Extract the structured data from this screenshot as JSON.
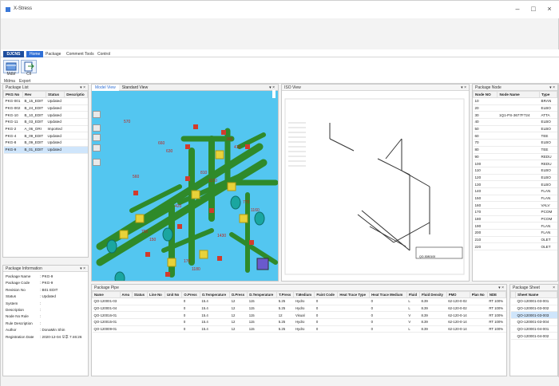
{
  "window": {
    "title": "X-Stress"
  },
  "ribbon": {
    "logo": "DJCNS",
    "tabs": [
      "Home",
      "Package",
      "Comment Tools",
      "Control"
    ],
    "active_tab": "Home",
    "buttons": [
      {
        "label": "Mdbf",
        "icon": "database-icon"
      },
      {
        "label": "Cll",
        "icon": "export-arrow-icon"
      }
    ],
    "groups": [
      "Mdma",
      "Export"
    ]
  },
  "package_list": {
    "title": "Package List",
    "columns": [
      "PKG No",
      "Rev",
      "Status",
      "Descriptio"
    ],
    "rows": [
      [
        "PKG-001",
        "B_15_EDIT",
        "Updated",
        ""
      ],
      [
        "PKG-002",
        "B_24_EDIT",
        "Updated",
        ""
      ],
      [
        "PKG-10",
        "B_10_EDIT",
        "Updated",
        ""
      ],
      [
        "PKG-11",
        "B_03_EDIT",
        "Updated",
        ""
      ],
      [
        "PKG-2",
        "A_06_ORI",
        "Imported",
        ""
      ],
      [
        "PKG-4",
        "B_09_EDIT",
        "Updated",
        ""
      ],
      [
        "PKG-8",
        "B_09_EDIT",
        "Updated",
        ""
      ],
      [
        "PKG-9",
        "B_01_EDIT",
        "Updated",
        ""
      ]
    ],
    "selected_index": 7
  },
  "package_information": {
    "title": "Package Information",
    "fields": [
      [
        "Package Name",
        ": PKG-9"
      ],
      [
        "Package Code",
        ": PKG-9"
      ],
      [
        "Revision No",
        ": B01 EDIT"
      ],
      [
        "Status",
        ": Updated"
      ],
      [
        "System",
        ":"
      ],
      [
        "Description",
        ":"
      ],
      [
        "Node No Rule",
        ":"
      ],
      [
        "Rule Description",
        ":"
      ],
      [
        "Author",
        ": DonaMin Shin"
      ],
      [
        "Registration Date",
        ": 2020-12-04 오후 7:46:26"
      ]
    ]
  },
  "model_view": {
    "tabs": [
      "Model View",
      "Standard View"
    ],
    "active": "Model View",
    "labels": [
      "570",
      "630",
      "1170",
      "1160",
      "150",
      "1180",
      "410",
      "560",
      "420",
      "1430",
      "1150",
      "660",
      "810",
      "770",
      "790",
      "170",
      "380"
    ]
  },
  "iso_view": {
    "title": "ISO View",
    "drawing_no": "QO-3080100"
  },
  "package_node": {
    "title": "Package Node",
    "columns": [
      "Node NO",
      "Node Name",
      "Type"
    ],
    "rows": [
      [
        "10",
        "",
        "BRAN"
      ],
      [
        "20",
        "",
        "ELBO"
      ],
      [
        "30",
        "1Q1-PS-3677F724",
        "ATTA"
      ],
      [
        "40",
        "",
        "ELBO"
      ],
      [
        "50",
        "",
        "ELBO"
      ],
      [
        "60",
        "",
        "TEE"
      ],
      [
        "70",
        "",
        "ELBO"
      ],
      [
        "80",
        "",
        "TEE"
      ],
      [
        "90",
        "",
        "REDU"
      ],
      [
        "100",
        "",
        "REDU"
      ],
      [
        "110",
        "",
        "ELBO"
      ],
      [
        "120",
        "",
        "ELBO"
      ],
      [
        "130",
        "",
        "ELBO"
      ],
      [
        "140",
        "",
        "FLAN"
      ],
      [
        "150",
        "",
        "FLAN"
      ],
      [
        "160",
        "",
        "VALV"
      ],
      [
        "170",
        "",
        "PCOM"
      ],
      [
        "180",
        "",
        "PCOM"
      ],
      [
        "190",
        "",
        "FLAN"
      ],
      [
        "200",
        "",
        "FLAN"
      ],
      [
        "210",
        "",
        "OLET"
      ],
      [
        "220",
        "",
        "OLET"
      ]
    ]
  },
  "package_pipe": {
    "title": "Package Pipe",
    "columns": [
      "Name",
      "Area",
      "Status",
      "Line No",
      "Unit No",
      "O.Press",
      "O.Temperature",
      "D.Press",
      "D.Temperature",
      "T.Press",
      "T.Medium",
      "Paint Code",
      "Heat Trace Type",
      "Heat Trace Medium",
      "Fluid",
      "Fluid Density",
      "PMO",
      "Plan No",
      "NDE"
    ],
    "rows": [
      [
        "QO-120001-03",
        "",
        "",
        "",
        "",
        "0",
        "15.4",
        "12",
        "115",
        "5.25",
        "Hydro",
        "0",
        "",
        "0",
        "L",
        "8.39",
        "62-120-0-02",
        "",
        "RT 100%"
      ],
      [
        "QO-120001-04",
        "",
        "",
        "",
        "",
        "0",
        "15.4",
        "12",
        "115",
        "5.25",
        "Hydro",
        "0",
        "",
        "0",
        "L",
        "8.39",
        "62-120-0-02",
        "",
        "RT 100%"
      ],
      [
        "QO-120016-01",
        "",
        "",
        "",
        "",
        "0",
        "15.4",
        "12",
        "115",
        "12",
        "Visual",
        "0",
        "",
        "0",
        "V",
        "8.39",
        "62-120-0-14",
        "",
        "RT 100%"
      ],
      [
        "QO-120015-01",
        "",
        "",
        "",
        "",
        "0",
        "15.4",
        "12",
        "115",
        "5.25",
        "Hydro",
        "0",
        "",
        "0",
        "V",
        "8.39",
        "62-120-0-14",
        "",
        "RT 100%"
      ],
      [
        "QO-120009-01",
        "",
        "",
        "",
        "",
        "0",
        "15.4",
        "12",
        "115",
        "5.25",
        "Hydro",
        "0",
        "",
        "0",
        "L",
        "8.39",
        "62-120-0-14",
        "",
        "RT 100%"
      ]
    ]
  },
  "package_sheet": {
    "title": "Package Sheet",
    "columns": [
      "Sheet Name"
    ],
    "rows": [
      "QO-120001-03-001",
      "QO-120001-03-002",
      "QO-120001-03-003",
      "QO-120001-03-004",
      "QO-120001-04-001",
      "QO-120001-04-002"
    ],
    "selected_index": 2
  },
  "colors": {
    "accent": "#2f6fd6",
    "pipe": "#2f8a2a",
    "background3d": "#53c6f0",
    "support": "#d23b2c",
    "flange": "#e8d23a"
  }
}
